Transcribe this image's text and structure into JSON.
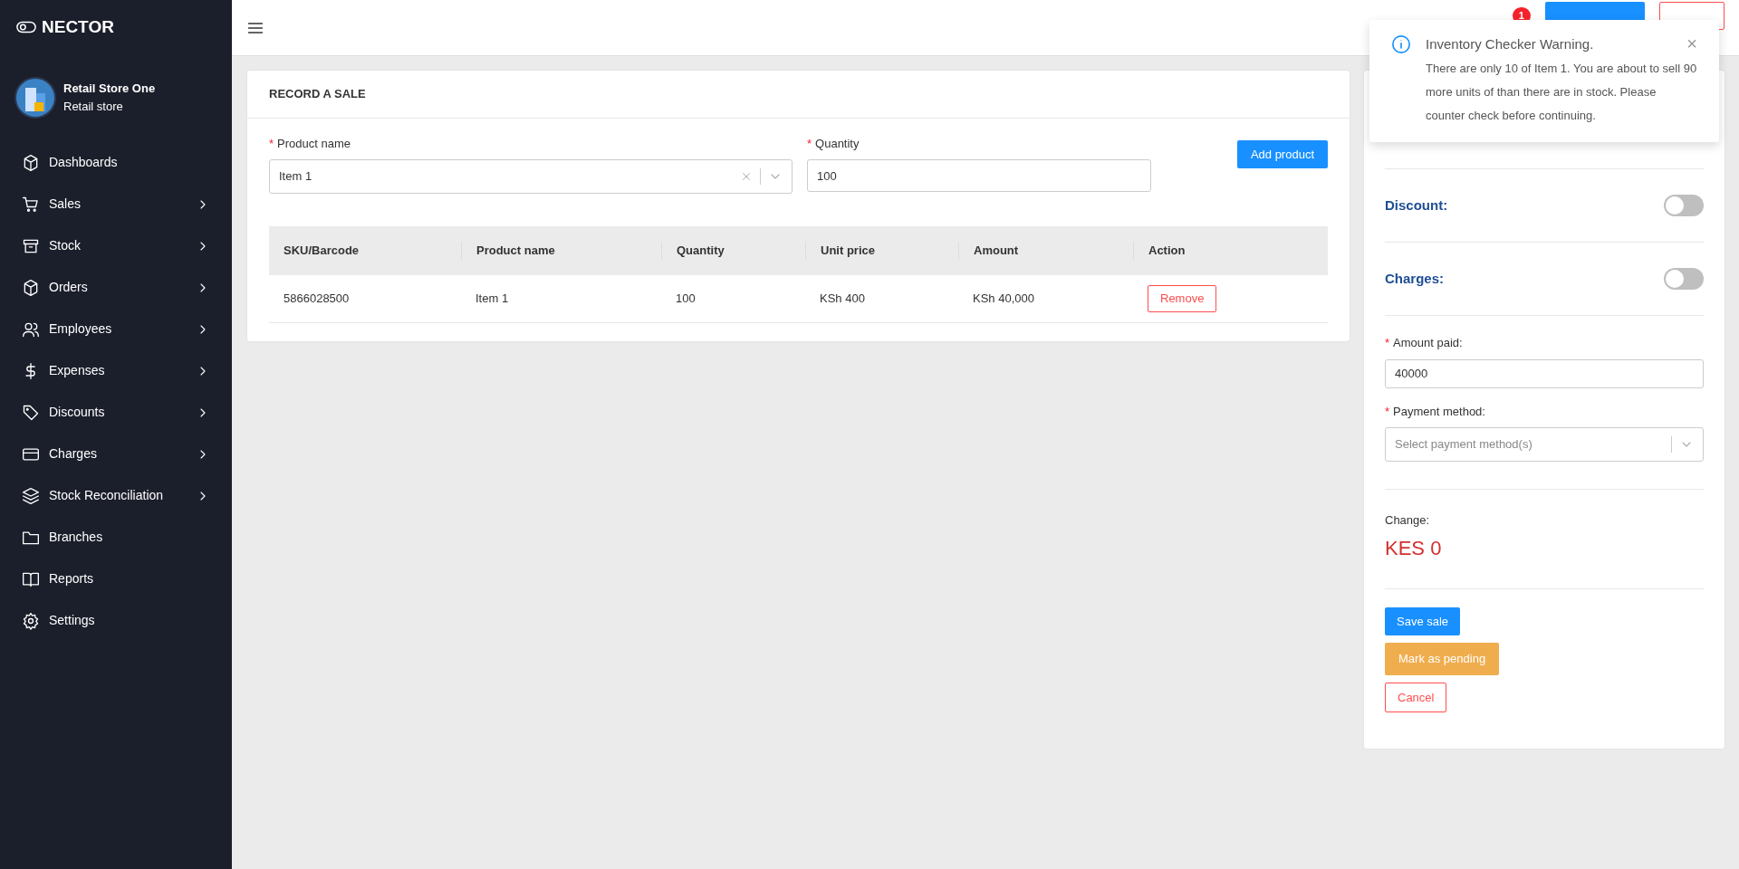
{
  "brand": "NECTOR",
  "store": {
    "name": "Retail Store One",
    "type": "Retail store"
  },
  "sidebar": {
    "items": [
      {
        "label": "Dashboards",
        "expandable": false
      },
      {
        "label": "Sales",
        "expandable": true
      },
      {
        "label": "Stock",
        "expandable": true
      },
      {
        "label": "Orders",
        "expandable": true
      },
      {
        "label": "Employees",
        "expandable": true
      },
      {
        "label": "Expenses",
        "expandable": true
      },
      {
        "label": "Discounts",
        "expandable": true
      },
      {
        "label": "Charges",
        "expandable": true
      },
      {
        "label": "Stock Reconciliation",
        "expandable": true
      },
      {
        "label": "Branches",
        "expandable": false
      },
      {
        "label": "Reports",
        "expandable": false
      },
      {
        "label": "Settings",
        "expandable": false
      }
    ]
  },
  "header": {
    "notification_count": "1"
  },
  "record_sale": {
    "title": "RECORD A SALE",
    "product_field": {
      "required_mark": "*",
      "label": "Product name",
      "value": "Item 1"
    },
    "quantity_field": {
      "required_mark": "*",
      "label": "Quantity",
      "value": "100"
    },
    "add_button": "Add product",
    "table": {
      "columns": [
        "SKU/Barcode",
        "Product name",
        "Quantity",
        "Unit price",
        "Amount",
        "Action"
      ],
      "rows": [
        {
          "cells": [
            "5866028500",
            "Item 1",
            "100",
            "KSh 400",
            "KSh 40,000"
          ],
          "action": "Remove"
        }
      ]
    }
  },
  "summary": {
    "toggles": [
      {
        "label": "Discount:",
        "on": false
      },
      {
        "label": "Charges:",
        "on": false
      }
    ],
    "amount_paid": {
      "required_mark": "*",
      "label": "Amount paid:",
      "value": "40000"
    },
    "payment_method": {
      "required_mark": "*",
      "label": "Payment method:",
      "placeholder": "Select payment method(s)"
    },
    "change_label": "Change:",
    "change_value": "KES 0",
    "buttons": [
      {
        "label": "Save sale",
        "kind": "primary"
      },
      {
        "label": "Mark as pending",
        "kind": "warning"
      },
      {
        "label": "Cancel",
        "kind": "danger"
      }
    ]
  },
  "toast": {
    "title": "Inventory Checker Warning.",
    "message": "There are only 10 of Item 1. You are about to sell 90 more units of than there are in stock. Please counter check before continuing.",
    "close": "×"
  }
}
